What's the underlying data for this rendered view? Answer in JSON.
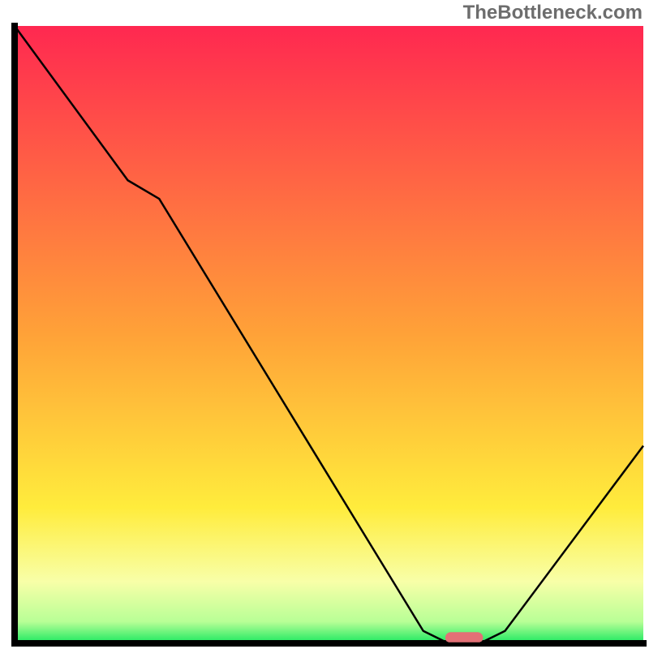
{
  "watermark": "TheBottleneck.com",
  "chart_data": {
    "type": "line",
    "title": "",
    "xlabel": "",
    "ylabel": "",
    "xlim": [
      0,
      100
    ],
    "ylim": [
      0,
      100
    ],
    "x": [
      0,
      18,
      23,
      65,
      69,
      74,
      78,
      100
    ],
    "values": [
      100,
      75,
      72,
      2,
      0,
      0,
      2,
      32
    ],
    "gradient_stops": [
      {
        "offset": 0.0,
        "color": "#ff2850"
      },
      {
        "offset": 0.5,
        "color": "#ffa238"
      },
      {
        "offset": 0.78,
        "color": "#ffec3c"
      },
      {
        "offset": 0.9,
        "color": "#f8ffa8"
      },
      {
        "offset": 0.965,
        "color": "#b8ff96"
      },
      {
        "offset": 1.0,
        "color": "#1ae860"
      }
    ],
    "marker": {
      "x": 71.5,
      "y": 0,
      "width": 6,
      "height": 1.8,
      "color": "#e37076"
    },
    "axis_color": "#000000",
    "line_color": "#000000",
    "line_width": 2.5
  }
}
